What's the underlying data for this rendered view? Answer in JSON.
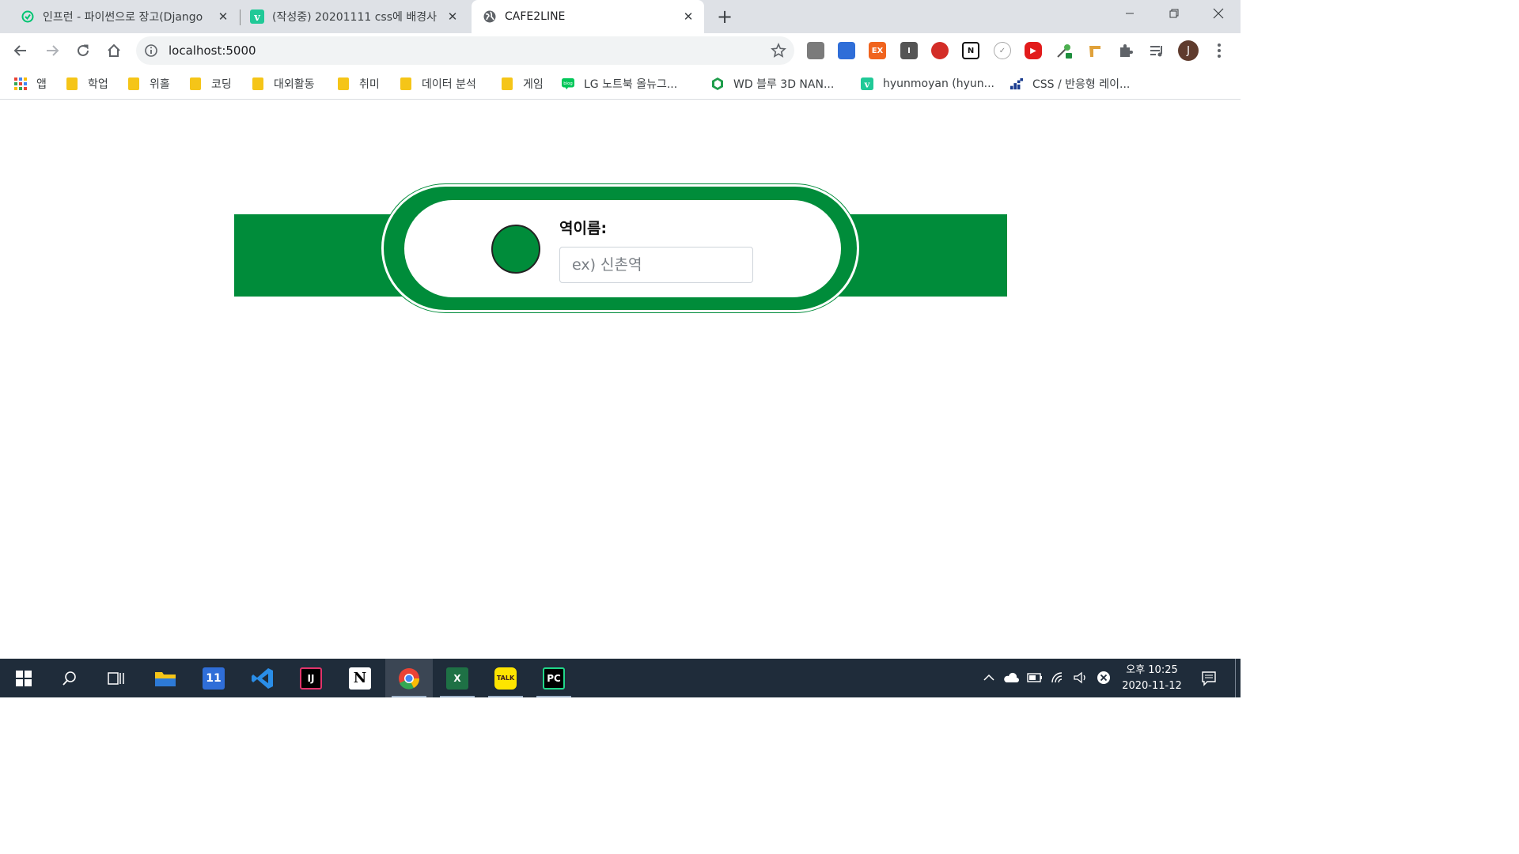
{
  "tabs": [
    {
      "title": "인프런 - 파이썬으로 장고(Django",
      "favicon": "inflearn-icon",
      "active": false
    },
    {
      "title": "(작성중) 20201111 css에 배경사",
      "favicon": "velog-icon",
      "active": false
    },
    {
      "title": "CAFE2LINE",
      "favicon": "globe-icon",
      "active": true
    }
  ],
  "omnibox": {
    "url": "localhost:5000"
  },
  "extensions": [
    "scrapbook-icon",
    "folder-ext-icon",
    "ex-icon",
    "instapaper-icon",
    "lastpass-icon",
    "notion-icon",
    "check-icon",
    "youtube-icon",
    "picker-icon",
    "ruler-icon",
    "puzzle-icon",
    "playlist-icon"
  ],
  "ext_labels": {
    "ex": "EX",
    "instapaper": "I",
    "notion": "N"
  },
  "profile": {
    "initial": "J"
  },
  "bookmarks": [
    {
      "label": "앱",
      "icon": "apps-grid-icon"
    },
    {
      "label": "학업",
      "icon": "folder-icon"
    },
    {
      "label": "위홀",
      "icon": "folder-icon"
    },
    {
      "label": "코딩",
      "icon": "folder-icon"
    },
    {
      "label": "대외활동",
      "icon": "folder-icon"
    },
    {
      "label": "취미",
      "icon": "folder-icon"
    },
    {
      "label": "데이터 분석",
      "icon": "folder-icon"
    },
    {
      "label": "게임",
      "icon": "folder-icon"
    },
    {
      "label": "LG 노트북 올뉴그...",
      "icon": "blog-icon"
    },
    {
      "label": "WD 블루 3D NAN...",
      "icon": "wd-icon"
    },
    {
      "label": "hyunmoyan (hyun...",
      "icon": "velog-icon"
    },
    {
      "label": "CSS / 반응형 레이...",
      "icon": "css-icon"
    }
  ],
  "bookmark_badges": {
    "blog": "blog",
    "velog": "v"
  },
  "sign": {
    "label": "역이름:",
    "input_placeholder": "ex) 신촌역",
    "input_value": "",
    "line_color": "#008c3a"
  },
  "taskbar": {
    "apps": [
      "windows-start-icon",
      "search-icon",
      "task-view-icon",
      "file-explorer-icon",
      "calendar-icon",
      "vscode-icon",
      "intellij-icon",
      "notion-icon",
      "chrome-icon",
      "excel-icon",
      "kakaotalk-icon",
      "pycharm-icon"
    ],
    "app_labels": {
      "calendar": "11",
      "intellij": "IJ",
      "notion": "N",
      "excel": "X",
      "kakaotalk": "TALK",
      "pycharm": "PC"
    },
    "clock": {
      "time": "오후 10:25",
      "date": "2020-11-12"
    }
  }
}
